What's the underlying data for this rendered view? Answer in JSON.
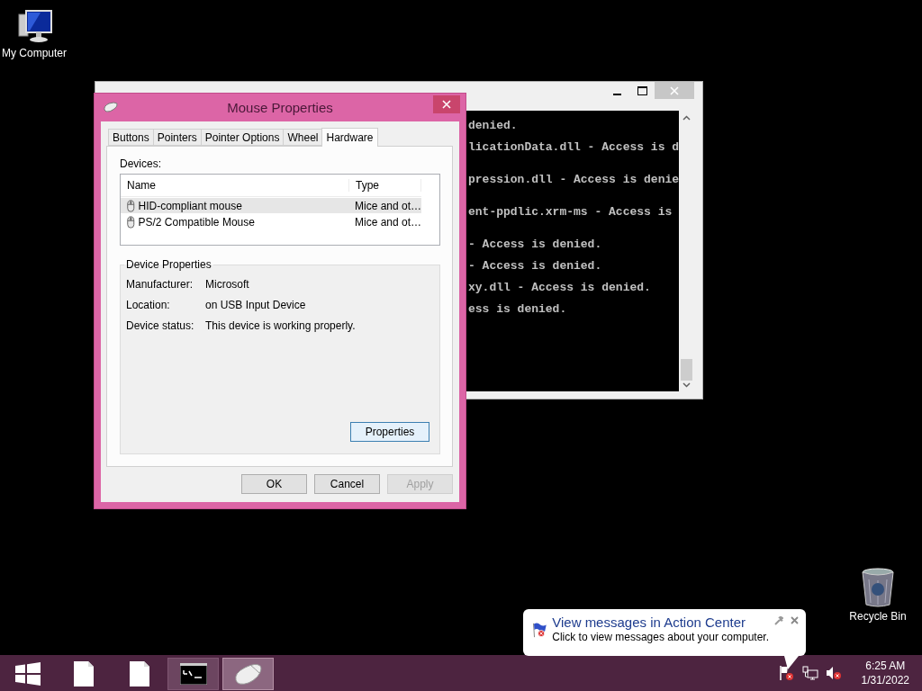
{
  "desktop_icons": [
    {
      "kind": "computer",
      "label": "My Computer"
    },
    {
      "kind": "bin",
      "label": "Recycle Bin"
    }
  ],
  "console": {
    "blocks": [
      {
        "lines": [
          "denied.",
          "licationData.dll - Access is d"
        ]
      },
      {
        "lines": [
          "pression.dll - Access is denie"
        ]
      },
      {
        "lines": [
          "ent-ppdlic.xrm-ms - Access is"
        ]
      },
      {
        "lines": [
          "- Access is denied.",
          "- Access is denied.",
          "xy.dll - Access is denied.",
          "ess is denied."
        ]
      }
    ]
  },
  "dialog": {
    "title": "Mouse Properties",
    "tabs": [
      {
        "label": "Buttons",
        "selected": false
      },
      {
        "label": "Pointers",
        "selected": false
      },
      {
        "label": "Pointer Options",
        "selected": false
      },
      {
        "label": "Wheel",
        "selected": false
      },
      {
        "label": "Hardware",
        "selected": true
      }
    ],
    "devices_label": "Devices:",
    "columns": [
      "Name",
      "Type"
    ],
    "rows": [
      {
        "name": "HID-compliant mouse",
        "type": "Mice and ot…",
        "selected": true
      },
      {
        "name": "PS/2 Compatible Mouse",
        "type": "Mice and ot…",
        "selected": false
      }
    ],
    "group_title": "Device Properties",
    "properties": [
      {
        "label": "Manufacturer:",
        "value": "Microsoft"
      },
      {
        "label": "Location:",
        "value": "on USB Input Device"
      },
      {
        "label": "Device status:",
        "value": "This device is working properly."
      }
    ],
    "properties_button": "Properties",
    "buttons": [
      {
        "label": "OK",
        "disabled": false
      },
      {
        "label": "Cancel",
        "disabled": false
      },
      {
        "label": "Apply",
        "disabled": true
      }
    ]
  },
  "balloon": {
    "title": "View messages in Action Center",
    "text": "Click to view messages about your computer."
  },
  "taskbar": {
    "items": [
      {
        "kind": "start",
        "open": false,
        "selected": false
      },
      {
        "kind": "file",
        "open": false,
        "selected": false
      },
      {
        "kind": "file",
        "open": false,
        "selected": false
      },
      {
        "kind": "console",
        "open": true,
        "selected": false
      },
      {
        "kind": "mouse",
        "open": true,
        "selected": true
      }
    ],
    "time": "6:25 AM",
    "date": "1/31/2022"
  }
}
